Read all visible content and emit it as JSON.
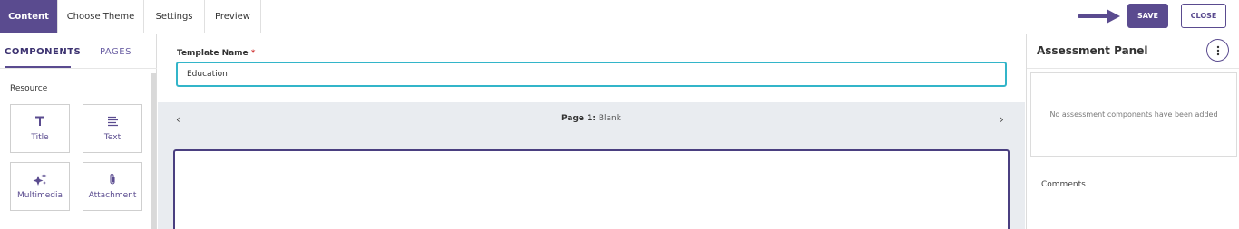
{
  "topbar": {
    "tabs": [
      {
        "label": "Content",
        "active": true
      },
      {
        "label": "Choose Theme",
        "active": false
      },
      {
        "label": "Settings",
        "active": false
      },
      {
        "label": "Preview",
        "active": false
      }
    ],
    "save_label": "SAVE",
    "close_label": "CLOSE"
  },
  "leftpanel": {
    "tabs": [
      {
        "label": "COMPONENTS",
        "active": true
      },
      {
        "label": "PAGES",
        "active": false
      }
    ],
    "section_label": "Resource",
    "components": [
      {
        "label": "Title",
        "icon": "title-icon"
      },
      {
        "label": "Text",
        "icon": "text-icon"
      },
      {
        "label": "Multimedia",
        "icon": "multimedia-icon"
      },
      {
        "label": "Attachment",
        "icon": "attachment-icon"
      }
    ]
  },
  "center": {
    "template_name_label": "Template Name",
    "required_mark": "*",
    "template_name_value": "Education",
    "page_number_label": "Page 1:",
    "page_name": "Blank"
  },
  "rightpanel": {
    "title": "Assessment Panel",
    "empty_message": "No assessment components have been added",
    "comments_label": "Comments"
  },
  "colors": {
    "accent": "#5a4b8f",
    "input_focus": "#33b5c9",
    "page_bar_bg": "#e9ecf0"
  }
}
